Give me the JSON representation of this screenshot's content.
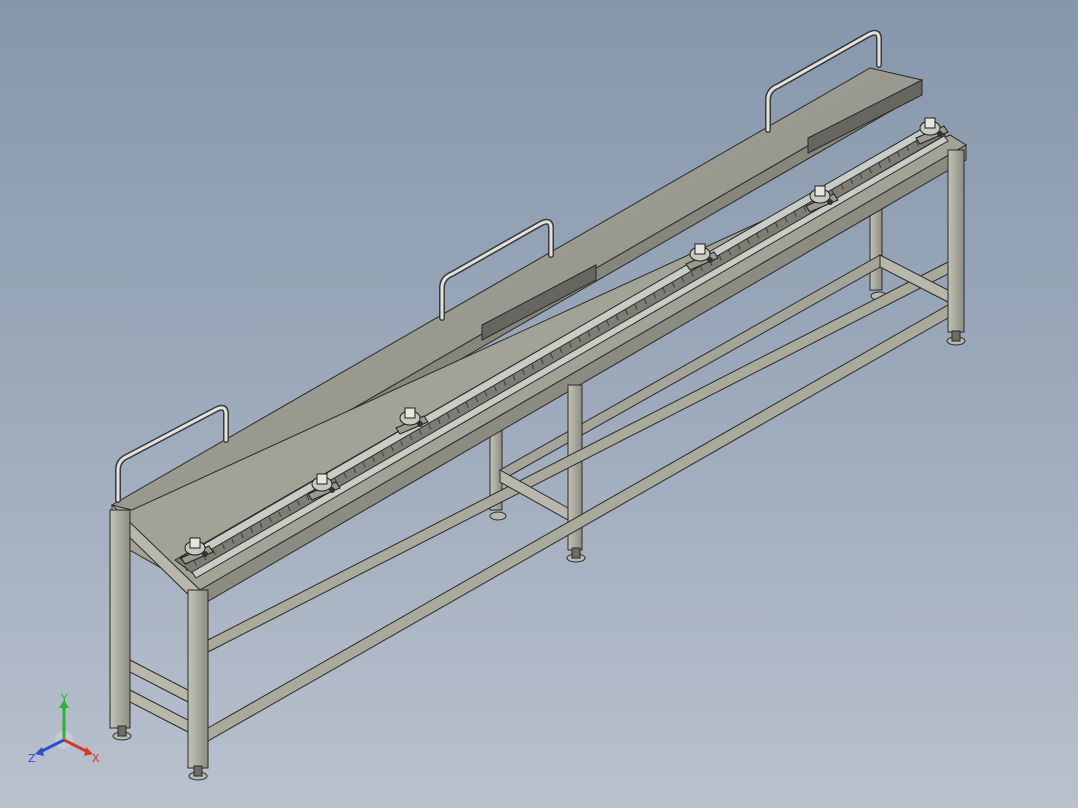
{
  "viewport": {
    "background_top": "#8797ab",
    "background_bottom": "#b9c1cd"
  },
  "model": {
    "description_icon": "conveyor-frame-3d-model",
    "frame_color": "#a9a99c",
    "frame_edge_color": "#2a2a2a",
    "top_surface_color": "#9d9d92",
    "rail_color": "#c9cbc6",
    "carriage_count": 6
  },
  "triad": {
    "x_label": "X",
    "y_label": "Y",
    "z_label": "Z",
    "x_color": "#d23a2a",
    "y_color": "#2db23a",
    "z_color": "#2a4fd0"
  }
}
